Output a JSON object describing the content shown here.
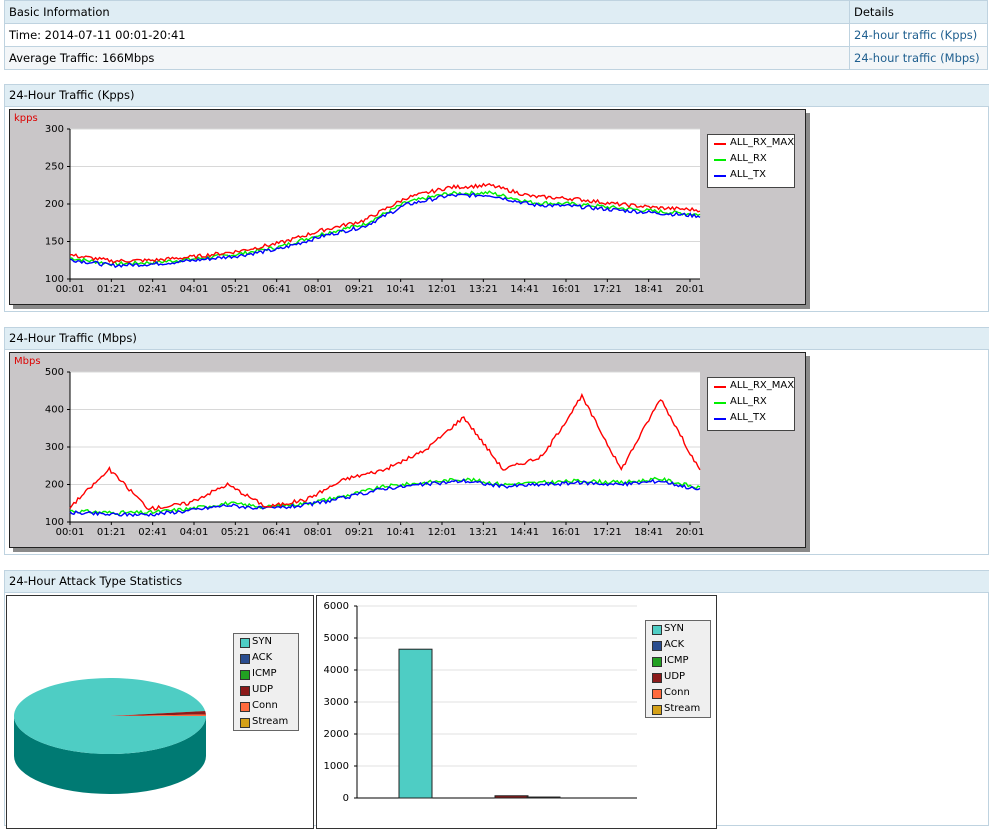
{
  "basic_info": {
    "header_label": "Basic Information",
    "details_label": "Details",
    "time": "Time: 2014-07-11 00:01-20:41",
    "average": "Average Traffic: 166Mbps",
    "link_kpps": "24-hour traffic (Kpps)",
    "link_mbps": "24-hour traffic (Mbps)"
  },
  "sections": {
    "kpps_title": "24-Hour Traffic (Kpps)",
    "mbps_title": "24-Hour Traffic (Mbps)",
    "attack_title": "24-Hour Attack Type Statistics"
  },
  "legend_series": [
    "ALL_RX_MAX",
    "ALL_RX",
    "ALL_TX"
  ],
  "series_colors": {
    "ALL_RX_MAX": "#ff0000",
    "ALL_RX": "#00ee00",
    "ALL_TX": "#0000ff"
  },
  "attack_types": [
    {
      "label": "SYN",
      "color": "#4ecdc4"
    },
    {
      "label": "ACK",
      "color": "#2a4d8f"
    },
    {
      "label": "ICMP",
      "color": "#22a022"
    },
    {
      "label": "UDP",
      "color": "#8b1a1a"
    },
    {
      "label": "Conn",
      "color": "#ff6a3d"
    },
    {
      "label": "Stream",
      "color": "#d4a017"
    }
  ],
  "chart_data": [
    {
      "type": "line",
      "ylabel": "kpps",
      "ylim": [
        100,
        300
      ],
      "yticks": [
        100,
        150,
        200,
        250,
        300
      ],
      "xticks": [
        "00:01",
        "01:21",
        "02:41",
        "04:01",
        "05:21",
        "06:41",
        "08:01",
        "09:21",
        "10:41",
        "12:01",
        "13:21",
        "14:41",
        "16:01",
        "17:21",
        "18:41",
        "20:01"
      ],
      "legend": "top-right",
      "grid": true,
      "series": [
        {
          "name": "ALL_RX_MAX",
          "values": [
            132,
            124,
            125,
            130,
            137,
            148,
            165,
            178,
            208,
            222,
            225,
            210,
            207,
            200,
            195,
            192
          ]
        },
        {
          "name": "ALL_RX",
          "values": [
            128,
            120,
            122,
            127,
            133,
            143,
            160,
            173,
            202,
            214,
            215,
            202,
            200,
            195,
            190,
            186
          ]
        },
        {
          "name": "ALL_TX",
          "values": [
            126,
            118,
            120,
            125,
            131,
            140,
            157,
            170,
            199,
            211,
            212,
            199,
            197,
            192,
            188,
            184
          ]
        }
      ]
    },
    {
      "type": "line",
      "ylabel": "Mbps",
      "ylim": [
        100,
        500
      ],
      "yticks": [
        100,
        200,
        300,
        400,
        500
      ],
      "xticks": [
        "00:01",
        "01:21",
        "02:41",
        "04:01",
        "05:21",
        "06:41",
        "08:01",
        "09:21",
        "10:41",
        "12:01",
        "13:21",
        "14:41",
        "16:01",
        "17:21",
        "18:41",
        "20:01"
      ],
      "legend": "top-right",
      "grid": true,
      "series": [
        {
          "name": "ALL_RX_MAX",
          "values": [
            140,
            240,
            135,
            150,
            200,
            140,
            160,
            215,
            240,
            290,
            380,
            240,
            275,
            435,
            240,
            430,
            235
          ]
        },
        {
          "name": "ALL_RX",
          "values": [
            130,
            125,
            125,
            135,
            150,
            140,
            150,
            170,
            195,
            205,
            215,
            200,
            205,
            210,
            205,
            215,
            190
          ]
        },
        {
          "name": "ALL_TX",
          "values": [
            125,
            120,
            120,
            130,
            145,
            135,
            145,
            165,
            190,
            200,
            210,
            195,
            200,
            205,
            200,
            210,
            185
          ]
        }
      ]
    },
    {
      "type": "pie",
      "categories": [
        "SYN",
        "ACK",
        "ICMP",
        "UDP",
        "Conn",
        "Stream"
      ],
      "values": [
        4650,
        0,
        0,
        70,
        30,
        0
      ],
      "legend": "right"
    },
    {
      "type": "bar",
      "categories": [
        "SYN",
        "ACK",
        "ICMP",
        "UDP",
        "Conn",
        "Stream"
      ],
      "values": [
        4650,
        0,
        0,
        70,
        30,
        0
      ],
      "ylim": [
        0,
        6000
      ],
      "yticks": [
        0,
        1000,
        2000,
        3000,
        4000,
        5000,
        6000
      ],
      "legend": "right"
    }
  ]
}
